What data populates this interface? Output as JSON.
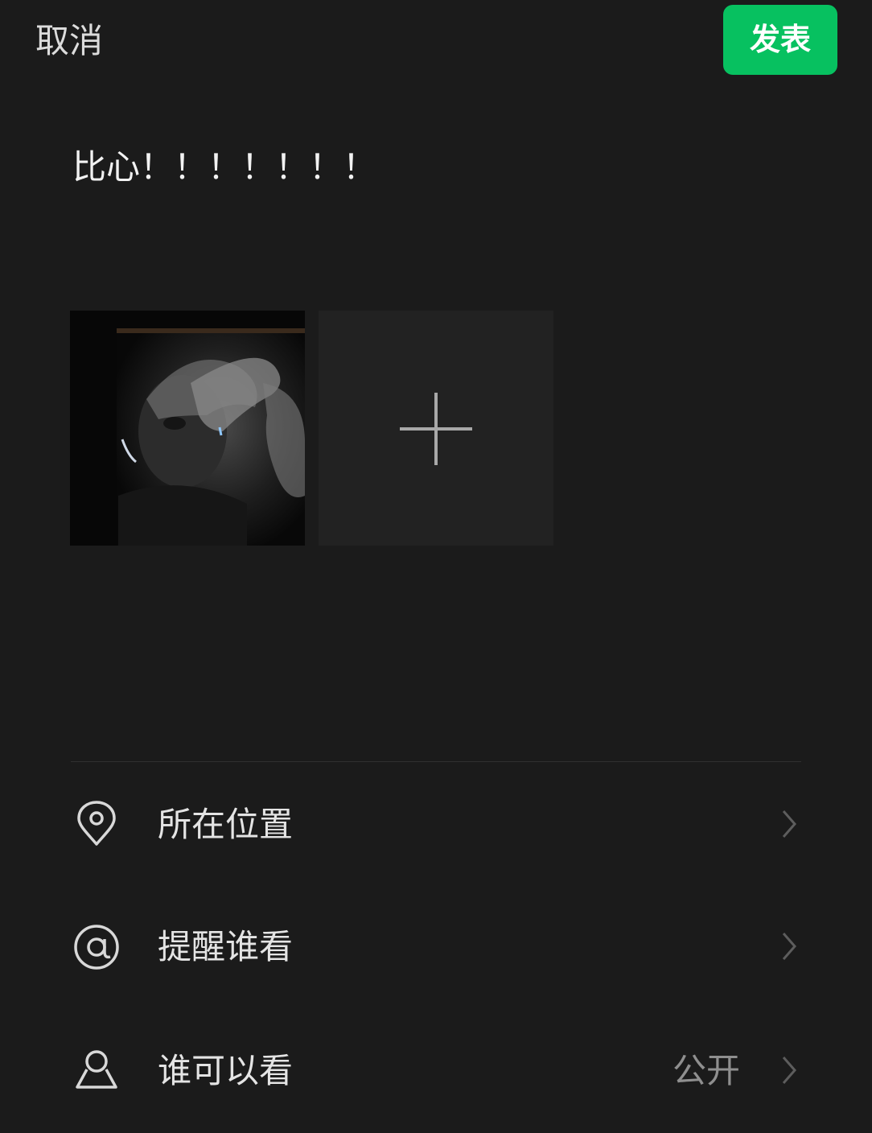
{
  "header": {
    "cancel_label": "取消",
    "publish_label": "发表"
  },
  "post": {
    "text": "比心！！！！！！！"
  },
  "colors": {
    "background": "#1b1b1b",
    "accent_green": "#07c160",
    "tile_background": "#222222",
    "secondary_text": "#8f8f8f"
  },
  "options": [
    {
      "label": "所在位置",
      "icon": "location-pin-icon",
      "value": ""
    },
    {
      "label": "提醒谁看",
      "icon": "at-sign-icon",
      "value": ""
    },
    {
      "label": "谁可以看",
      "icon": "person-icon",
      "value": "公开"
    }
  ]
}
